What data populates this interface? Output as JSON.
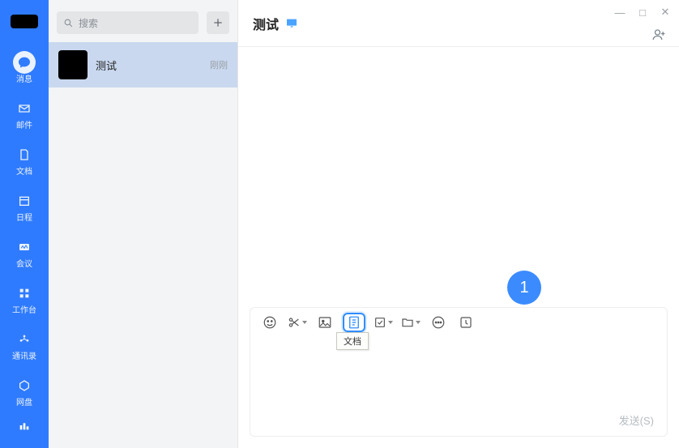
{
  "nav": {
    "items": [
      {
        "id": "messages",
        "label": "消息"
      },
      {
        "id": "mail",
        "label": "邮件"
      },
      {
        "id": "docs",
        "label": "文档"
      },
      {
        "id": "calendar",
        "label": "日程"
      },
      {
        "id": "meeting",
        "label": "会议"
      },
      {
        "id": "workbench",
        "label": "工作台"
      },
      {
        "id": "contacts",
        "label": "通讯录"
      },
      {
        "id": "drive",
        "label": "网盘"
      }
    ]
  },
  "search": {
    "placeholder": "搜索"
  },
  "conversations": [
    {
      "title": "测试",
      "time": "刚刚"
    }
  ],
  "chat": {
    "title": "测试",
    "callout_number": "1",
    "tooltip": "文档",
    "send_label": "发送(S)"
  },
  "window": {
    "minimize": "—",
    "maximize": "□",
    "close": "✕"
  },
  "colors": {
    "brand": "#2f7bff",
    "accent": "#3b8bff",
    "highlight": "#2f8dff"
  }
}
